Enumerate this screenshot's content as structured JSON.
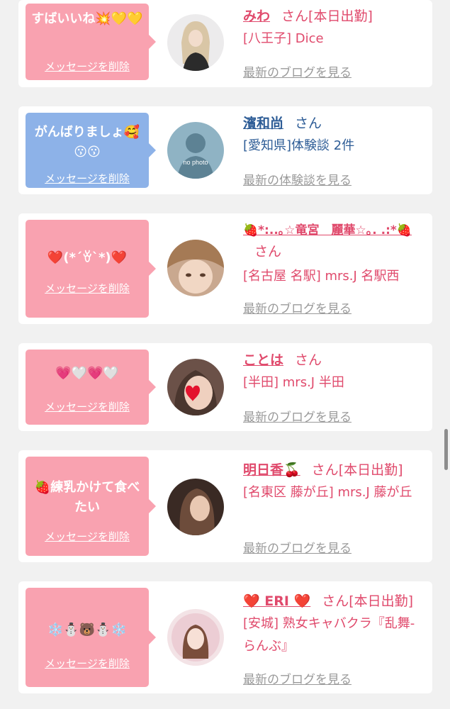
{
  "cards": [
    {
      "message": "すばいいね💥💛💛",
      "delete_label": "メッセージを削除",
      "name": "みわ",
      "san": "さん",
      "status": "[本日出勤]",
      "shop": "[八王子] Dice",
      "more": "最新のブログを見る",
      "bubble_color": "#f9a2b0"
    },
    {
      "message": "がんばりましょ🥰😗😗",
      "delete_label": "メッセージを削除",
      "name": "濱和尚",
      "san": "さん",
      "status": "",
      "shop": "[愛知県]体験談 2件",
      "more": "最新の体験談を見る",
      "avatar_text": "no photo",
      "bubble_color": "#8db2e8"
    },
    {
      "message": "❤️(*´ꈊ`*)❤️",
      "delete_label": "メッセージを削除",
      "name": "🍓*:..｡☆竜宮　麗華☆｡. .:*🍓",
      "san": "さん",
      "status": "",
      "shop": "[名古屋 名駅] mrs.J 名駅西",
      "more": "最新のブログを見る",
      "bubble_color": "#f9a2b0"
    },
    {
      "message": "💗🤍💗🤍",
      "delete_label": "メッセージを削除",
      "name": "ことは",
      "san": "さん",
      "status": "",
      "shop": "[半田] mrs.J 半田",
      "more": "最新のブログを見る",
      "bubble_color": "#f9a2b0"
    },
    {
      "message": "🍓練乳かけて食べたい",
      "delete_label": "メッセージを削除",
      "name": "明日香🍒",
      "san": "さん",
      "status": "[本日出勤]",
      "shop": "[名東区 藤が丘] mrs.J 藤が丘",
      "more": "最新のブログを見る",
      "bubble_color": "#f9a2b0"
    },
    {
      "message": "❄️⛄🐻⛄❄️",
      "delete_label": "メッセージを削除",
      "name": "❤️ ERI ❤️",
      "san": "さん",
      "status": "[本日出勤]",
      "shop": "[安城] 熟女キャバクラ『乱舞-らんぶ』",
      "more": "最新のブログを見る",
      "bubble_color": "#f9a2b0"
    }
  ],
  "colors": {
    "background": "#f1f1f1",
    "pink_bubble": "#f9a2b0",
    "blue_bubble": "#8db2e8",
    "name_pink": "#e04a6c",
    "name_blue": "#2d5c96",
    "link_gray": "#9a9a9a"
  },
  "icons": [
    "scrollbar-thumb"
  ]
}
